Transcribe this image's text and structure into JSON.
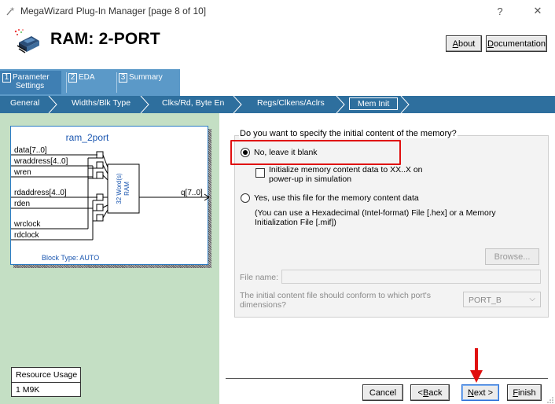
{
  "window": {
    "title": "MegaWizard Plug-In Manager [page 8 of 10]",
    "help_glyph": "?",
    "close_glyph": "✕"
  },
  "header": {
    "title": "RAM: 2-PORT",
    "about_label": "About",
    "about_u": "A",
    "about_rest": "bout",
    "doc_u": "D",
    "doc_rest": "ocumentation"
  },
  "steps": [
    {
      "num": "1",
      "label_line1": "Parameter",
      "label_line2": "Settings",
      "active": true
    },
    {
      "num": "2",
      "label": "EDA"
    },
    {
      "num": "3",
      "label": "Summary"
    }
  ],
  "crumbs": [
    "General",
    "Widths/Blk Type",
    "Clks/Rd, Byte En",
    "Regs/Clkens/Aclrs",
    "Mem Init"
  ],
  "symbol": {
    "name": "ram_2port",
    "inputs": [
      "data[7..0]",
      "wraddress[4..0]",
      "wren",
      "rdaddress[4..0]",
      "rden",
      "wrclock",
      "rdclock"
    ],
    "output": "q[7..0]",
    "core_line1": "32 Word(s)",
    "core_line2": "RAM",
    "block_type": "Block Type: AUTO"
  },
  "resource": {
    "label": "Resource Usage",
    "value": "1 M9K"
  },
  "mem_init": {
    "question": "Do you want to specify the initial content of the memory?",
    "opt_blank": "No, leave it blank",
    "init_line1": "Initialize memory content data to XX..X on",
    "init_line2": "power-up in simulation",
    "opt_file": "Yes, use this file for the memory content data",
    "hint_line1": "(You can use a Hexadecimal (Intel-format) File [.hex] or a Memory",
    "hint_line2": "Initialization File [.mif])",
    "browse_label": "Browse...",
    "file_name_label": "File name:",
    "file_name_value": "",
    "port_q_line1": "The initial content file should conform to which port's",
    "port_q_line2": "dimensions?",
    "port_value": "PORT_B"
  },
  "footer": {
    "cancel": "Cancel",
    "back_pre": "< ",
    "back_u": "B",
    "back_rest": "ack",
    "next_u": "N",
    "next_rest": "ext >",
    "finish_u": "F",
    "finish_rest": "inish"
  },
  "colors": {
    "tab_blue": "#5b99c8",
    "crumb_blue": "#2e6f9e",
    "left_panel_green": "#c4dfc4",
    "annotation_red": "#e01010"
  }
}
